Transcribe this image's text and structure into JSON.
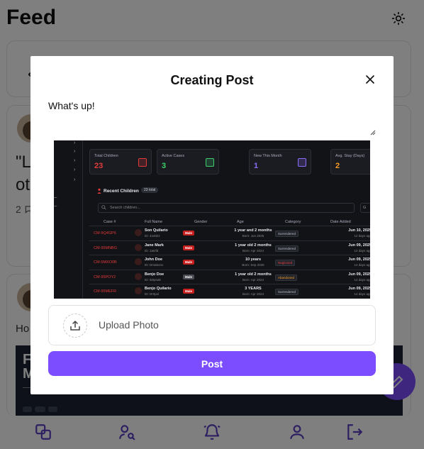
{
  "page": {
    "title": "Feed"
  },
  "background_posts": {
    "post1": {
      "quote_line1": "\"L",
      "quote_line2": "ot",
      "comment_count": "2"
    },
    "post2": {
      "text": "Ho"
    }
  },
  "modal": {
    "title": "Creating Post",
    "text_value": "What's up!",
    "upload_label": "Upload Photo",
    "post_button": "Post"
  },
  "dashboard_image": {
    "stats": [
      {
        "label": "Total Children",
        "value": "23",
        "color": "#e23a3a"
      },
      {
        "label": "Active Cases",
        "value": "3",
        "color": "#3ecf6a"
      },
      {
        "label": "New This Month",
        "value": "1",
        "color": "#8b6cff"
      },
      {
        "label": "Avg. Stay (Days)",
        "value": "2",
        "color": "#f59a23"
      }
    ],
    "recent_title": "Recent Children",
    "total_badge": "23 total",
    "search_placeholder": "Search children...",
    "filter_label": "G",
    "headers": [
      "Case #",
      "Full Name",
      "Gender",
      "Age",
      "Category",
      "Date Added"
    ],
    "rows": [
      {
        "case": "CM-9Q4GP6",
        "name": "Son Quilario",
        "id": "ID: 4o4tt2z",
        "gender": "Male",
        "age": "1 year and 2 months",
        "born": "Born: Jun 2025",
        "category": "Surrendered",
        "date": "Jun 10, 2025",
        "ago": "12 days ago"
      },
      {
        "case": "CM-95MNBG",
        "name": "Jane Mark",
        "id": "ID: 1atzfd",
        "gender": "Male",
        "age": "1 year old 2 months",
        "born": "Born: Apr 2024",
        "category": "Surrendered",
        "date": "Jun 09, 2025",
        "ago": "14 days ago"
      },
      {
        "case": "CM-5MXO0B",
        "name": "John Doe",
        "id": "ID: Dma5onv",
        "gender": "Male",
        "age": "10 years",
        "born": "Born: Sep 2025",
        "category": "Neglected",
        "date": "Jun 09, 2025",
        "ago": "14 days ago"
      },
      {
        "case": "CM-95POY2",
        "name": "Benjo Doe",
        "id": "ID: 5i0pnak",
        "gender": "Male",
        "age": "1 year old 2 months",
        "born": "Born: Apr 2024",
        "category": "Abandoned",
        "date": "Jun 09, 2025",
        "ago": "14 days ago"
      },
      {
        "case": "CM-95MEFR",
        "name": "Benjo Quilario",
        "id": "ID: Dr0pxl",
        "gender": "Male",
        "age": "3 YEARS",
        "born": "Born: Apr 2024",
        "category": "Surrendered",
        "date": "Jun 09, 2025",
        "ago": "14 days ago"
      }
    ],
    "category_colors": {
      "Surrendered": "#b8bcc8",
      "Neglected": "#e23a3a",
      "Abandoned": "#f59a23"
    }
  },
  "colors": {
    "accent": "#7c4dff",
    "overlay": "rgba(0,0,0,0.5)",
    "danger": "#e23a3a"
  },
  "icons": {
    "theme": "sun-icon",
    "close": "close-icon",
    "upload": "upload-icon",
    "nav": [
      "feed-icon",
      "user-search-icon",
      "bell-icon",
      "profile-icon",
      "logout-icon"
    ],
    "fab": "compose-icon"
  }
}
